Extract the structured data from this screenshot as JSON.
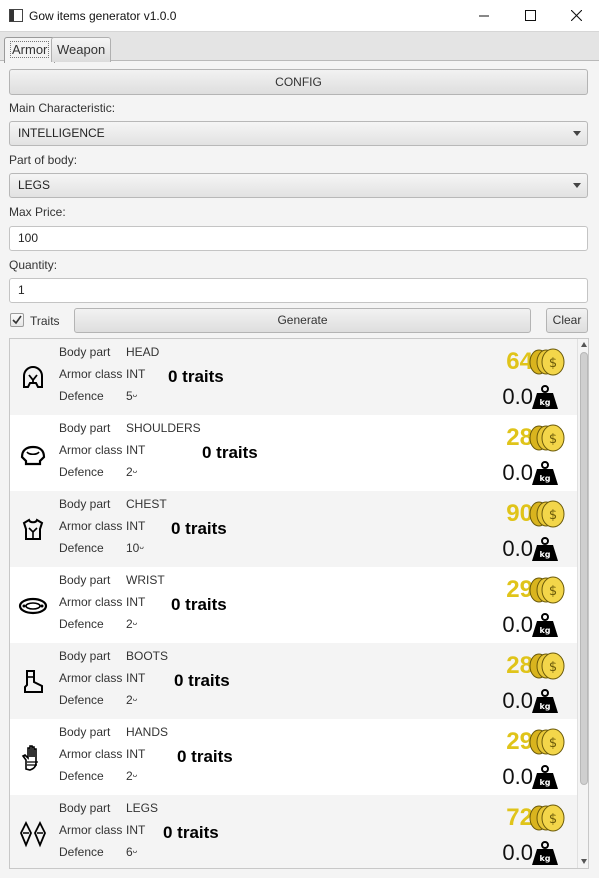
{
  "window": {
    "title": "Gow items generator v1.0.0"
  },
  "tabs": [
    {
      "label": "Armor",
      "active": true
    },
    {
      "label": "Weapon",
      "active": false
    }
  ],
  "form": {
    "config_label": "CONFIG",
    "main_char_label": "Main Characteristic:",
    "main_char_value": "INTELLIGENCE",
    "body_label": "Part of body:",
    "body_value": "LEGS",
    "price_label": "Max Price:",
    "price_value": "100",
    "quantity_label": "Quantity:",
    "quantity_value": "1",
    "traits_label": "Traits",
    "traits_checked": true,
    "generate_label": "Generate",
    "clear_label": "Clear"
  },
  "labels": {
    "body_part": "Body part",
    "armor_class": "Armor class",
    "defence": "Defence"
  },
  "items": [
    {
      "part": "HEAD",
      "armor_class": "INT",
      "defence": "5ᵕ",
      "traits": "0 traits",
      "price": "64",
      "weight": "0.0",
      "icon": "helmet-icon"
    },
    {
      "part": "SHOULDERS",
      "armor_class": "INT",
      "defence": "2ᵕ",
      "traits": "0 traits",
      "price": "28",
      "weight": "0.0",
      "icon": "shoulders-icon"
    },
    {
      "part": "CHEST",
      "armor_class": "INT",
      "defence": "10ᵕ",
      "traits": "0 traits",
      "price": "90",
      "weight": "0.0",
      "icon": "chest-armor-icon"
    },
    {
      "part": "WRIST",
      "armor_class": "INT",
      "defence": "2ᵕ",
      "traits": "0 traits",
      "price": "29",
      "weight": "0.0",
      "icon": "bracer-icon"
    },
    {
      "part": "BOOTS",
      "armor_class": "INT",
      "defence": "2ᵕ",
      "traits": "0 traits",
      "price": "28",
      "weight": "0.0",
      "icon": "boot-icon"
    },
    {
      "part": "HANDS",
      "armor_class": "INT",
      "defence": "2ᵕ",
      "traits": "0 traits",
      "price": "29",
      "weight": "0.0",
      "icon": "gauntlet-icon"
    },
    {
      "part": "LEGS",
      "armor_class": "INT",
      "defence": "6ᵕ",
      "traits": "0 traits",
      "price": "72",
      "weight": "0.0",
      "icon": "greaves-icon"
    }
  ],
  "icons": {
    "coins": "coins-icon",
    "weight": "kg-weight-icon",
    "weight_text": "kg"
  },
  "colors": {
    "price": "#e0c41a",
    "coin": "#e3c22a"
  }
}
